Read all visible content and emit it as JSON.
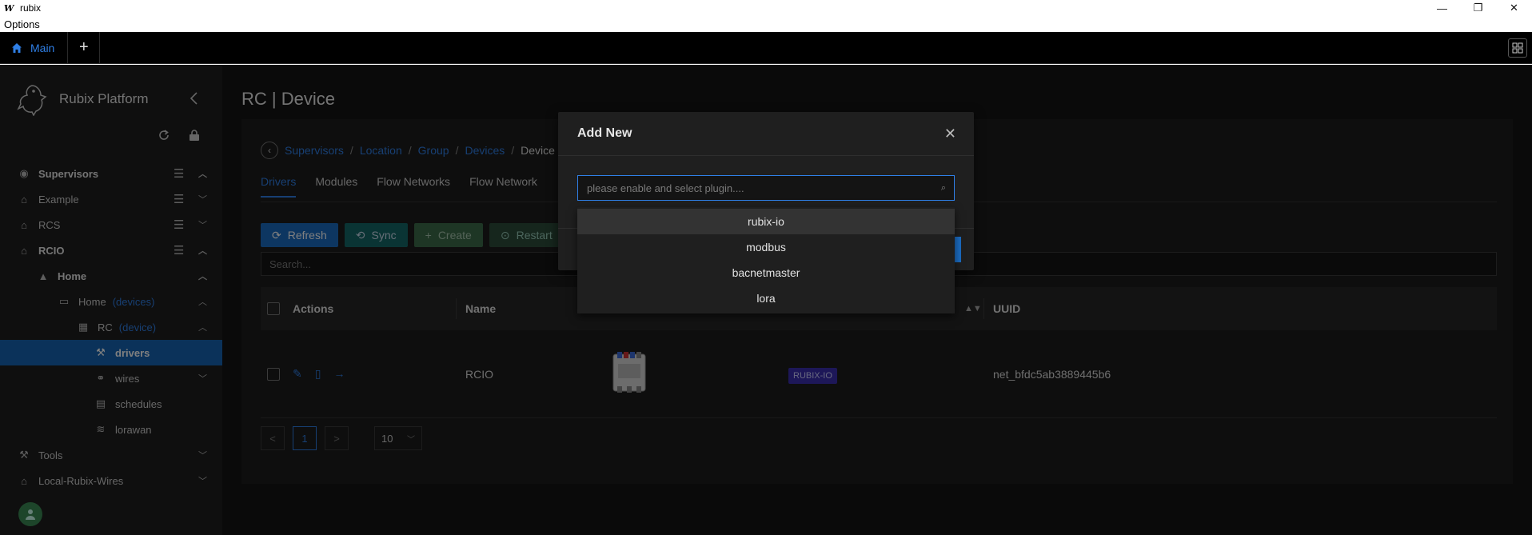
{
  "window": {
    "icon_glyph": "W",
    "title": "rubix",
    "minimize": "—",
    "restore": "❐",
    "close": "✕"
  },
  "menubar": {
    "options": "Options"
  },
  "app_tabs": {
    "main_label": "Main",
    "add": "+"
  },
  "sidebar": {
    "brand": "Rubix Platform",
    "items": [
      {
        "label": "Supervisors",
        "tag": ""
      },
      {
        "label": "Example",
        "tag": ""
      },
      {
        "label": "RCS",
        "tag": ""
      },
      {
        "label": "RCIO",
        "tag": ""
      },
      {
        "label": "Home",
        "tag": ""
      },
      {
        "label": "Home",
        "tag": "(devices)"
      },
      {
        "label": "RC",
        "tag": "(device)"
      },
      {
        "label": "drivers",
        "tag": ""
      },
      {
        "label": "wires",
        "tag": ""
      },
      {
        "label": "schedules",
        "tag": ""
      },
      {
        "label": "lorawan",
        "tag": ""
      },
      {
        "label": "Tools",
        "tag": ""
      },
      {
        "label": "Local-Rubix-Wires",
        "tag": ""
      }
    ]
  },
  "main": {
    "title": "RC | Device",
    "breadcrumb": [
      "Supervisors",
      "Location",
      "Group",
      "Devices",
      "Device"
    ],
    "tabs": [
      "Drivers",
      "Modules",
      "Flow Networks",
      "Flow Network"
    ],
    "buttons": {
      "refresh": "Refresh",
      "sync": "Sync",
      "create": "Create",
      "restart": "Restart"
    },
    "search_placeholder": "Search...",
    "table": {
      "headers": {
        "actions": "Actions",
        "name": "Name",
        "uuid": "UUID"
      },
      "row": {
        "name": "RCIO",
        "tag": "RUBIX-IO",
        "uuid": "net_bfdc5ab3889445b6"
      }
    },
    "pager": {
      "prev": "<",
      "page": "1",
      "next": ">",
      "size": "10"
    }
  },
  "modal": {
    "title": "Add New",
    "select_placeholder": "please enable and select plugin....",
    "options": [
      "rubix-io",
      "modbus",
      "bacnetmaster",
      "lora"
    ]
  },
  "colors": {
    "accent": "#2f7fe6",
    "active_nav": "#1765b4",
    "tag_purple": "#3b2fb0"
  }
}
